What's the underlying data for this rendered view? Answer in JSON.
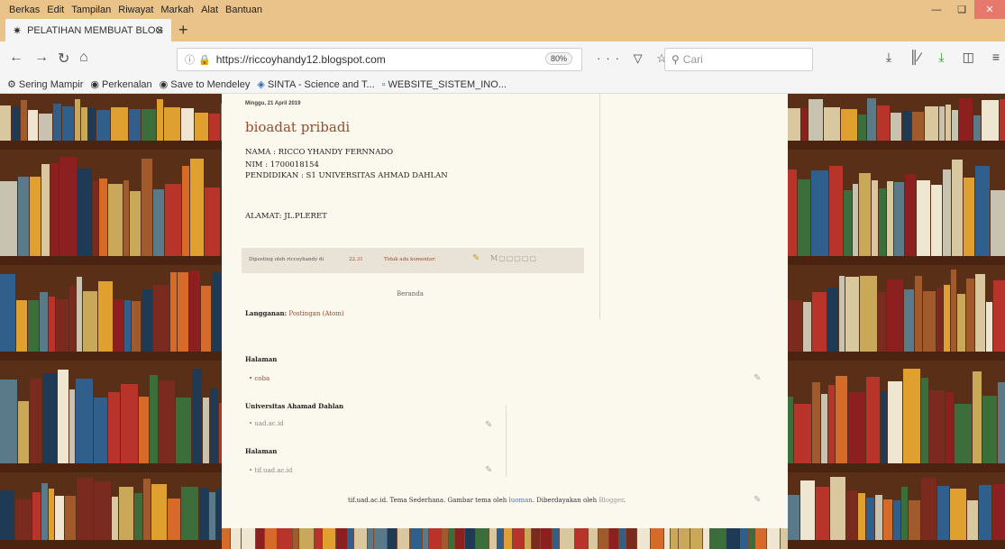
{
  "menubar": {
    "items": [
      "Berkas",
      "Edit",
      "Tampilan",
      "Riwayat",
      "Markah",
      "Alat",
      "Bantuan"
    ]
  },
  "tab": {
    "title": "PELATIHAN MEMBUAT BLOG"
  },
  "nav": {
    "url": "https://riccoyhandy12.blogspot.com",
    "zoom": "80%",
    "search_placeholder": "Cari"
  },
  "bookmarks": [
    {
      "icon": "gear-icon",
      "label": "Sering Mampir"
    },
    {
      "icon": "globe-icon",
      "label": "Perkenalan"
    },
    {
      "icon": "globe-icon",
      "label": "Save to Mendeley"
    },
    {
      "icon": "sinta-icon",
      "label": "SINTA - Science and T..."
    },
    {
      "icon": "page-icon",
      "label": "WEBSITE_SISTEM_INO..."
    }
  ],
  "post": {
    "date": "Minggu, 21 April 2019",
    "title": "bioadat pribadi",
    "nama": "NAMA : RICCO YHANDY FERNNADO",
    "nim": "NIM : 1700018154",
    "pendidikan": "PENDIDIKAN : S1 UNIVERSITAS AHMAD DAHLAN",
    "alamat": "ALAMAT: JL.PLERET",
    "posted_by": "Diposting oleh riccoyhandy di",
    "posted_time": "22.31",
    "comments": "Tidak ada komentar:"
  },
  "blog": {
    "beranda": "Beranda",
    "langganan_label": "Langganan:",
    "langganan_link": "Postingan (Atom)",
    "widget1_title": "Halaman",
    "widget1_link": "coba",
    "widget2_title": "Universitas Ahamad Dahlan",
    "widget2_link": "uad.ac.id",
    "widget3_title": "Halaman",
    "widget3_link": "tif.uad.ac.id",
    "credit_text": "tif.uad.ac.id. Tema Sederhana. Gambar tema oleh",
    "credit_author": "luoman",
    "credit_mid": ". Diberdayakan oleh",
    "credit_blogger": "Blogger"
  }
}
